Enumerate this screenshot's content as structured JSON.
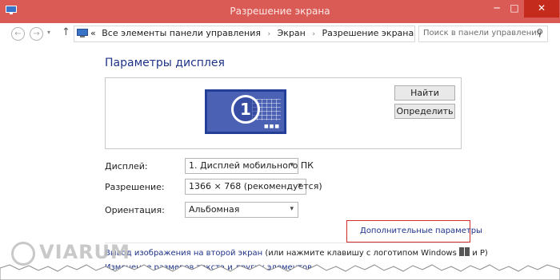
{
  "window": {
    "title": "Разрешение экрана",
    "controls": {
      "minimize": "─",
      "maximize": "□",
      "close": "✕"
    }
  },
  "addressbar": {
    "back": "←",
    "forward": "→",
    "dropdown": "▾",
    "up": "↑",
    "crumbs_prefix": "«",
    "crumbs": [
      "Все элементы панели управления",
      "Экран",
      "Разрешение экрана"
    ],
    "crumb_separator": "›",
    "refresh": "⟳",
    "search_placeholder": "Поиск в панели управления",
    "search_icon": "⚲"
  },
  "main": {
    "title": "Параметры дисплея",
    "monitor_number": "1",
    "buttons": {
      "find": "Найти",
      "identify": "Определить"
    },
    "fields": {
      "display": {
        "label": "Дисплей:",
        "value": "1. Дисплей мобильного ПК"
      },
      "resolution": {
        "label": "Разрешение:",
        "value": "1366 × 768 (рекомендуется)"
      },
      "orientation": {
        "label": "Ориентация:",
        "value": "Альбомная"
      }
    },
    "advanced_link": "Дополнительные параметры",
    "projector": {
      "link": "Вывод изображения на второй экран",
      "text": " (или нажмите клавишу с логотипом Windows ",
      "text_end": " и Р)"
    },
    "resize_text": "Изменение размеров текста и других элементов"
  },
  "watermark": "VIARUM",
  "colors": {
    "titlebar": "#da5a55",
    "close": "#c42b1c",
    "link": "#1e3287",
    "monitor": "#4b61b3",
    "highlight": "#d42b2b"
  }
}
